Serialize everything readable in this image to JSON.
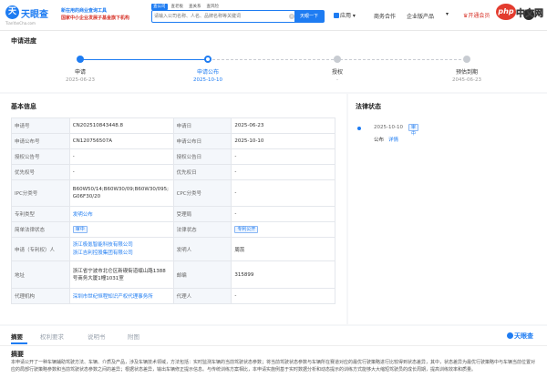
{
  "header": {
    "logo_mark": "天",
    "logo_name": "天眼查",
    "logo_domain": "TianYanCha.com",
    "slogan_line1": "新在用的商业查询工具",
    "slogan_line2": "国家中小企业发展子基金旗下机构",
    "search_tabs": [
      "查公司",
      "查老板",
      "查关系",
      "查风险"
    ],
    "search_placeholder": "请输入公司名称、人名、品牌名称等关键词",
    "search_button": "天眼一下",
    "apps_label": "应用",
    "nav": [
      "商务合作",
      "企业版产品"
    ],
    "vip_label": "开通会员",
    "watermark_mark": "php",
    "watermark_text": "中文网"
  },
  "progress": {
    "title": "申请进度",
    "steps": [
      {
        "label": "申请",
        "date": "2025-06-23",
        "state": "done"
      },
      {
        "label": "申请公布",
        "date": "2025-10-10",
        "state": "current"
      },
      {
        "label": "授权",
        "date": "-",
        "state": "pending"
      },
      {
        "label": "预估到期",
        "date": "2045-06-23",
        "state": "pending"
      }
    ]
  },
  "basic": {
    "title": "基本信息",
    "rows": [
      {
        "k1": "申请号",
        "v1": "CN202510843448.8",
        "k2": "申请日",
        "v2": "2025-06-23"
      },
      {
        "k1": "申请公布号",
        "v1": "CN120756507A",
        "k2": "申请公布日",
        "v2": "2025-10-10"
      },
      {
        "k1": "授权公告号",
        "v1": "-",
        "k2": "授权公告日",
        "v2": "-"
      },
      {
        "k1": "优先权号",
        "v1": "-",
        "k2": "优先权日",
        "v2": "-"
      },
      {
        "k1": "IPC分类号",
        "v1": "B60W50/14;B60W30/09;B60W30/095;G06F30/20",
        "k2": "CPC分类号",
        "v2": "-"
      },
      {
        "k1": "专利类型",
        "v1": "发明公布",
        "k2": "受理局",
        "v2": "-"
      },
      {
        "k1": "简单法律状态",
        "v1": "审中",
        "k2": "法律状态",
        "v2": "专利公开"
      },
      {
        "k1": "申请（专利权）人",
        "v1a": "浙江极氪智能科技有限公司",
        "v1b": "浙江吉利控股集团有限公司",
        "k2": "发明人",
        "v2": "周蕊"
      },
      {
        "k1": "地址",
        "v1": "浙江省宁波市北仑区新碶街道岷山路1388号商务大厦1幢1031室",
        "k2": "邮编",
        "v2": "315899"
      },
      {
        "k1": "代理机构",
        "v1": "深圳市世纪恒程知识产权代理事务所",
        "k2": "代理人",
        "v2": "-"
      }
    ]
  },
  "legal": {
    "title": "法律状态",
    "date": "2025-10-10",
    "tag": "审中",
    "type": "公布",
    "detail": "详情"
  },
  "tabs": {
    "items": [
      "摘要",
      "权利要求",
      "说明书",
      "附图"
    ],
    "logo": "天眼查"
  },
  "abstract": {
    "title": "摘要",
    "text": "本申请公开了一种车辆辅助驾驶方法、车辆、介质及产品，涉及车辆技术领域，方法包括：实时监测车辆的当前驾驶状态参数；将当前驾驶状态参数与车辆所在赛道对应的最优行驶策略进行比较得到状态差异，其中，状态差异为最优行驶策略中与车辆当前位置对应的局部行驶策略参数和当前驾驶状态参数之间的差异；根据状态差异，输出车辆修正提示信息。与传统训练方案相比，本申请实施例基于实时数据分析和动态提示的训练方式能够大大缩短驾驶员的成长周期，提高训练效率和质量。"
  },
  "colors": {
    "accent": "#1e7cf2",
    "vip": "#d7342a"
  }
}
